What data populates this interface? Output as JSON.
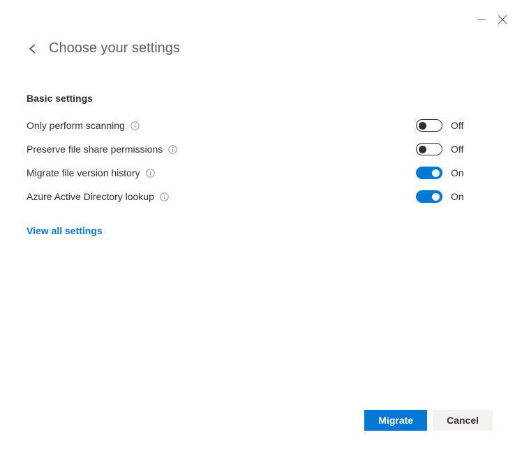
{
  "header": {
    "title": "Choose your settings"
  },
  "sections": {
    "basic": {
      "title": "Basic settings"
    }
  },
  "settings": [
    {
      "label": "Only perform scanning",
      "state": "Off",
      "on": false
    },
    {
      "label": "Preserve file share permissions",
      "state": "Off",
      "on": false
    },
    {
      "label": "Migrate file version history",
      "state": "On",
      "on": true
    },
    {
      "label": "Azure Active Directory lookup",
      "state": "On",
      "on": true
    }
  ],
  "links": {
    "view_all": "View all settings"
  },
  "footer": {
    "primary": "Migrate",
    "secondary": "Cancel"
  }
}
